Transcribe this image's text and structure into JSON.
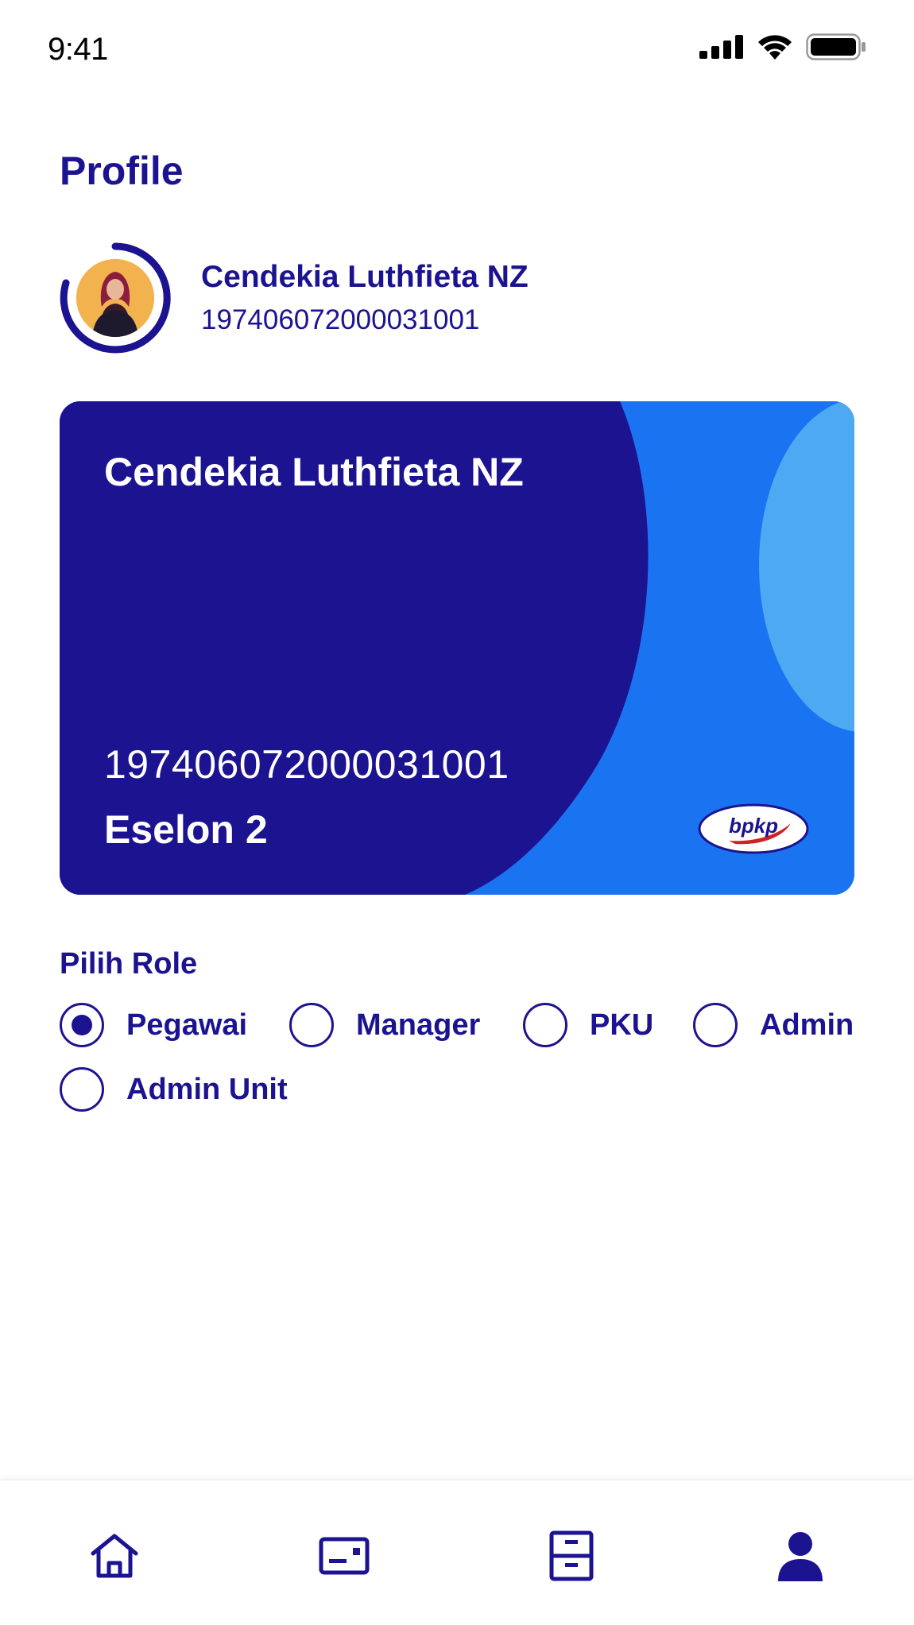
{
  "status_bar": {
    "time": "9:41",
    "icons": [
      "cellular-signal-icon",
      "wifi-icon",
      "battery-icon"
    ]
  },
  "page": {
    "title": "Profile"
  },
  "profile": {
    "name": "Cendekia Luthfieta NZ",
    "nip": "197406072000031001"
  },
  "card": {
    "name": "Cendekia Luthfieta NZ",
    "nip": "197406072000031001",
    "level": "Eselon 2",
    "logo_text": "bpkp",
    "colors": {
      "dark": "#1c1391",
      "mid": "#1a74f2",
      "light": "#4ea9f3"
    }
  },
  "roles": {
    "label": "Pilih Role",
    "options": [
      {
        "label": "Pegawai",
        "selected": true
      },
      {
        "label": "Manager",
        "selected": false
      },
      {
        "label": "PKU",
        "selected": false
      },
      {
        "label": "Admin",
        "selected": false
      },
      {
        "label": "Admin Unit",
        "selected": false
      }
    ]
  },
  "nav": {
    "items": [
      {
        "icon": "home-icon"
      },
      {
        "icon": "card-icon"
      },
      {
        "icon": "cabinet-icon"
      },
      {
        "icon": "user-icon",
        "active": true
      }
    ]
  },
  "theme": {
    "primary": "#1c1391"
  }
}
